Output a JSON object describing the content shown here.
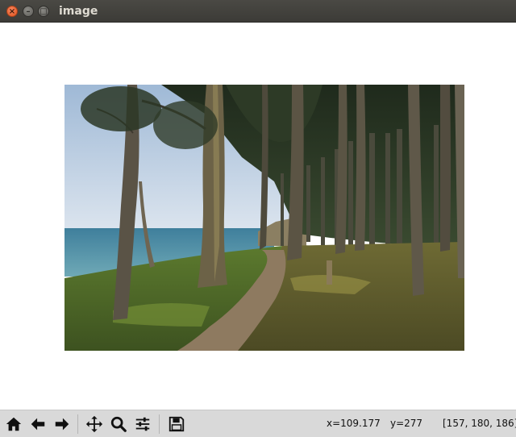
{
  "window": {
    "title": "image",
    "close_glyph": "×",
    "minimize_glyph": "–",
    "maximize_glyph": "□"
  },
  "image": {
    "description_icon": "photo-forest-coast",
    "content": "photograph"
  },
  "toolbar": {
    "buttons": [
      {
        "name": "home-button",
        "icon": "home-icon"
      },
      {
        "name": "back-button",
        "icon": "arrow-left-icon"
      },
      {
        "name": "forward-button",
        "icon": "arrow-right-icon"
      },
      {
        "name": "pan-button",
        "icon": "move-icon"
      },
      {
        "name": "zoom-button",
        "icon": "magnifier-icon"
      },
      {
        "name": "configure-subplots-button",
        "icon": "sliders-icon"
      },
      {
        "name": "save-button",
        "icon": "floppy-disk-icon"
      }
    ]
  },
  "status": {
    "x": "x=109.177",
    "y": "y=277",
    "pixel": "[157, 180, 186]"
  }
}
